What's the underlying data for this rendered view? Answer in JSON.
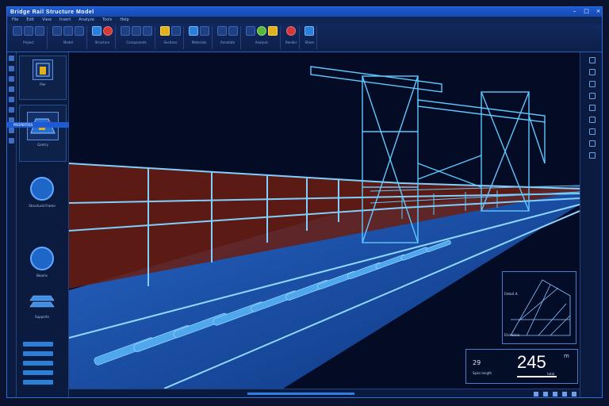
{
  "window": {
    "title": "Bridge Rail Structure Model"
  },
  "menu": [
    "File",
    "Edit",
    "View",
    "Insert",
    "Analyze",
    "Tools",
    "Help"
  ],
  "ribbon": {
    "groups": [
      {
        "label": "Project"
      },
      {
        "label": "Model"
      },
      {
        "label": "Structure"
      },
      {
        "label": "Components"
      },
      {
        "label": "Sections"
      },
      {
        "label": "Materials"
      },
      {
        "label": "Annotate"
      },
      {
        "label": "Analysis"
      },
      {
        "label": "Render"
      },
      {
        "label": "Share"
      }
    ]
  },
  "sidebar": {
    "cards": [
      {
        "label": "Pier"
      },
      {
        "label": "Gantry"
      }
    ],
    "tree_header": "PROPERTIES",
    "tiles": [
      {
        "label": "Structural Frame"
      },
      {
        "label": "Beams"
      },
      {
        "label": "Supports"
      }
    ]
  },
  "detail": {
    "title_label": "Detail A",
    "sub_label": "Elevation"
  },
  "readout": {
    "small_value": "29",
    "value": "245",
    "unit": "m",
    "caption": "Span length",
    "sub": "total"
  },
  "colors": {
    "accent": "#1d5bd4",
    "wireframe": "#5ec8ff",
    "track": "#7fd0ff",
    "background": "#040b24"
  }
}
